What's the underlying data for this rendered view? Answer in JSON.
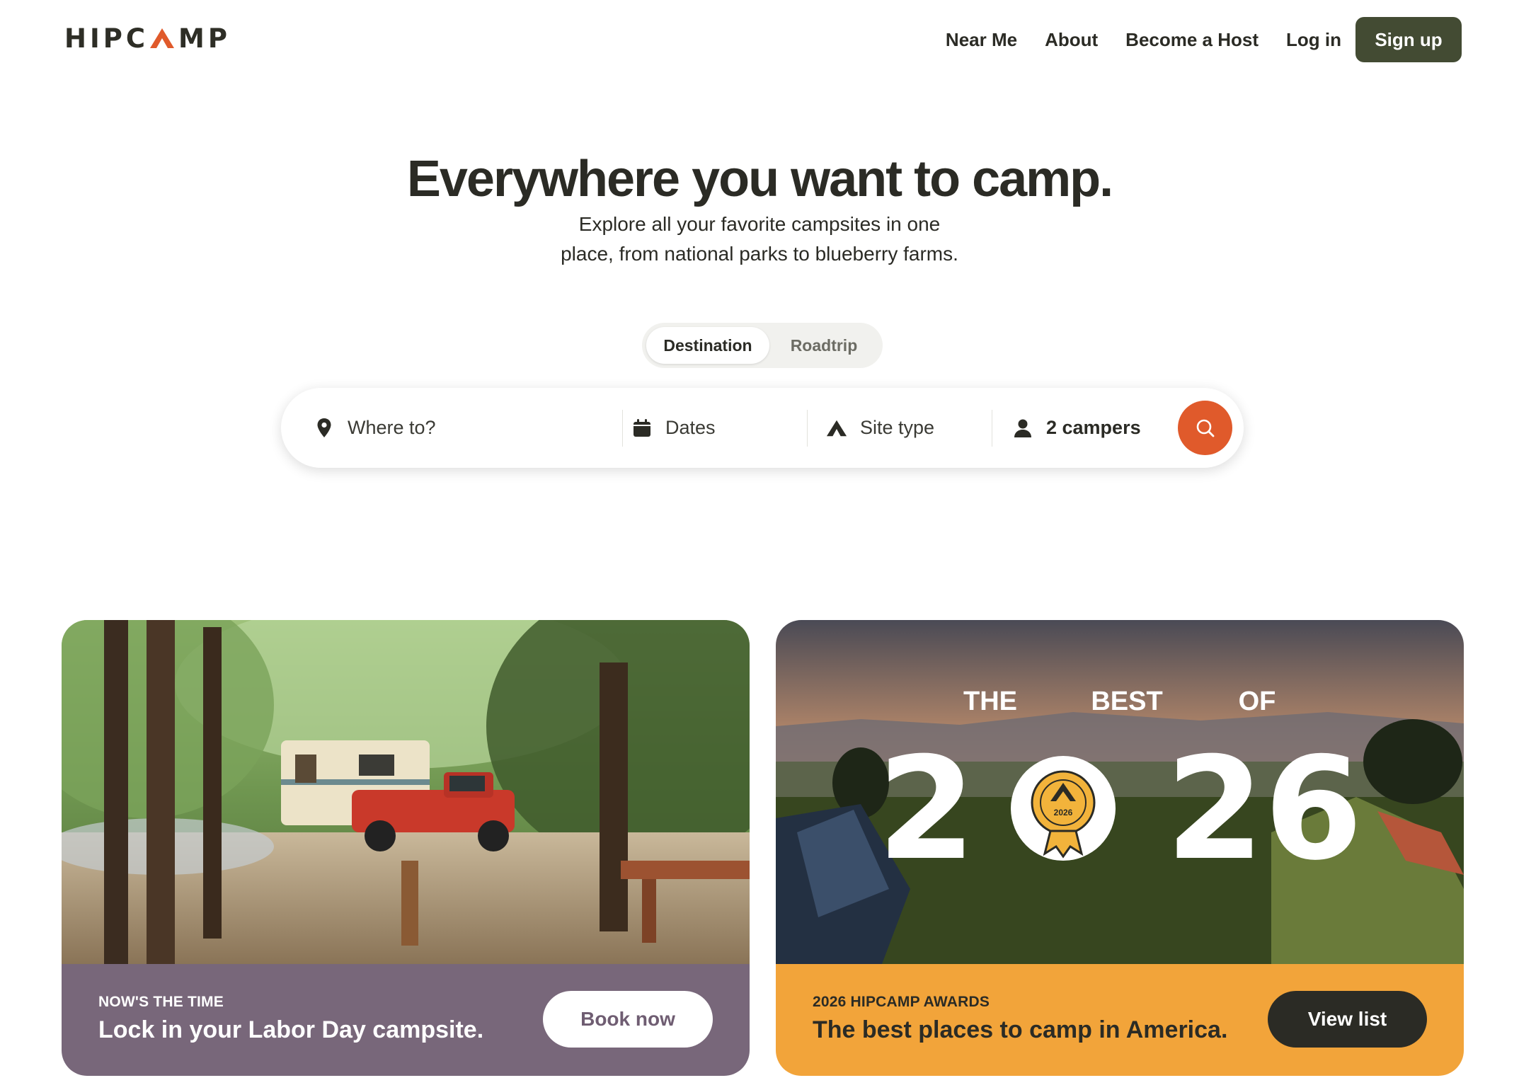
{
  "header": {
    "logo_text_left": "HIPC",
    "logo_text_right": "MP",
    "nav": [
      "Near Me",
      "About",
      "Become a Host",
      "Log in"
    ],
    "signup_label": "Sign up"
  },
  "hero": {
    "title": "Everywhere you want to camp.",
    "subtitle_line1": "Explore all your favorite campsites in one",
    "subtitle_line2": "place, from national parks to blueberry farms."
  },
  "search_mode": {
    "options": [
      "Destination",
      "Roadtrip"
    ],
    "selected": "Destination"
  },
  "search": {
    "where_placeholder": "Where to?",
    "dates_label": "Dates",
    "site_type_label": "Site type",
    "campers_label": "2 campers"
  },
  "cards": [
    {
      "eyebrow": "NOW'S THE TIME",
      "title": "Lock in your Labor Day campsite.",
      "button": "Book now",
      "color": "#78677a"
    },
    {
      "eyebrow": "2026 HIPCAMP AWARDS",
      "title": "The best places to camp in America.",
      "button": "View list",
      "color": "#f2a43a",
      "image_text": {
        "word1": "THE",
        "word2": "BEST",
        "word3": "OF",
        "year_left": "2",
        "year_right": "26",
        "badge_year": "2026"
      }
    }
  ],
  "colors": {
    "accent": "#e05a2b",
    "brand_dark": "#434b33"
  }
}
